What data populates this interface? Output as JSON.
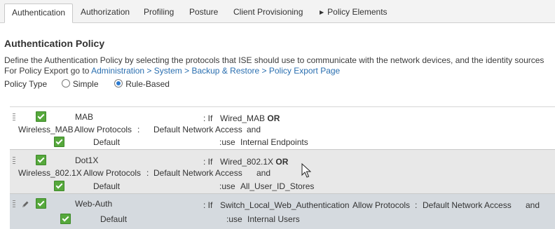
{
  "tabs": [
    "Authentication",
    "Authorization",
    "Profiling",
    "Posture",
    "Client Provisioning",
    "Policy Elements"
  ],
  "title": "Authentication Policy",
  "description": "Define the Authentication Policy by selecting the protocols that ISE should use to communicate with the network devices, and the identity sources",
  "export": {
    "prefix": "For Policy Export go to ",
    "link": "Administration > System > Backup & Restore > Policy Export Page"
  },
  "policy_type": {
    "label": "Policy Type",
    "simple": "Simple",
    "rule_based": "Rule-Based",
    "selected": "Rule-Based"
  },
  "rules": [
    {
      "name": "MAB",
      "if": ": If",
      "cond": "Wired_MAB",
      "op": "OR",
      "cond2": "Wireless_MAB",
      "allow": "Allow Protocols",
      "colon": ":",
      "protocol": "Default Network Access",
      "and": "and",
      "default": "Default",
      "use": ":use",
      "identity": "Internal Endpoints"
    },
    {
      "name": "Dot1X",
      "if": ": If",
      "cond": "Wired_802.1X",
      "op": "OR",
      "cond2": "Wireless_802.1X",
      "allow": "Allow Protocols",
      "colon": ":",
      "protocol": "Default Network Access",
      "and": "and",
      "default": "Default",
      "use": ":use",
      "identity": "All_User_ID_Stores"
    },
    {
      "name": "Web-Auth",
      "if": ": If",
      "cond": "Switch_Local_Web_Authentication",
      "allow": "Allow Protocols",
      "colon": ":",
      "protocol": "Default Network Access",
      "and": "and",
      "default": "Default",
      "use": ":use",
      "identity": "Internal Users"
    }
  ],
  "colors": {
    "accent": "#2a6fb0",
    "checkbox": "#56a83c",
    "row_alt": "#e8e8e8",
    "row_selected": "#d5dadf"
  },
  "icons": {
    "tab_expander": "triangle-right-icon",
    "edit": "pencil-icon",
    "drag": "drag-handle-icon",
    "cursor": "mouse-pointer-icon"
  }
}
